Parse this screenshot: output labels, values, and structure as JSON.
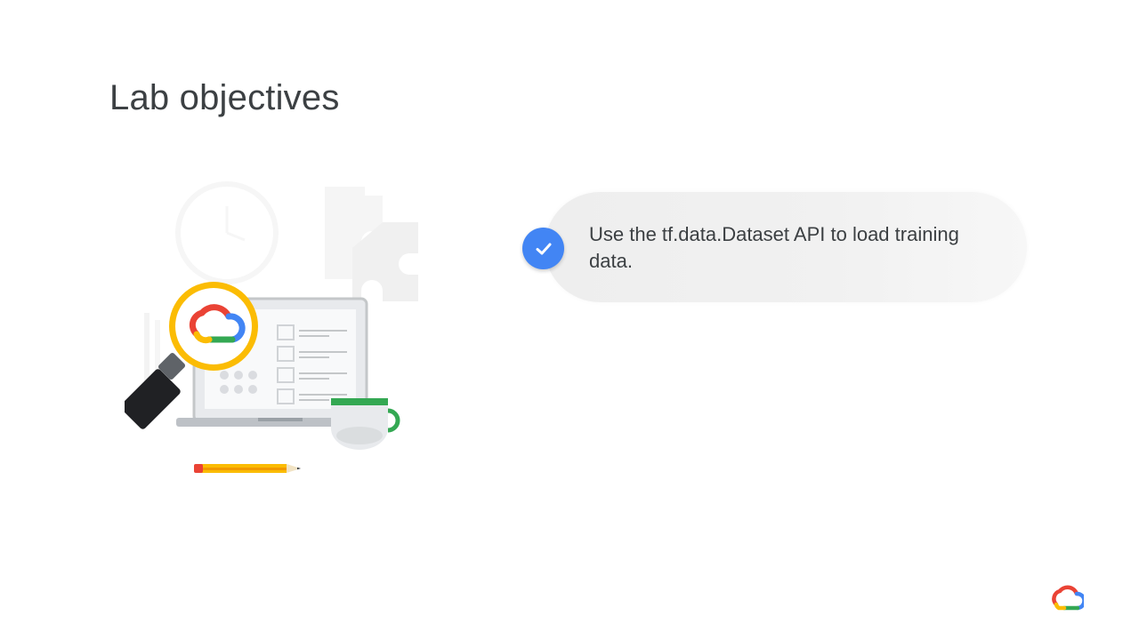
{
  "slide": {
    "title": "Lab objectives",
    "objectives": [
      {
        "text": "Use the tf.data.Dataset API to load training data.",
        "status_icon": "check-icon"
      }
    ]
  },
  "colors": {
    "title_text": "#3c4043",
    "check_badge": "#4285f4",
    "pill_background": "#eeeeee",
    "google_blue": "#4285f4",
    "google_red": "#ea4335",
    "google_yellow": "#fbbc04",
    "google_green": "#34a853"
  },
  "icons": {
    "illustration": "lab-illustration",
    "logo": "google-cloud-logo-icon"
  }
}
